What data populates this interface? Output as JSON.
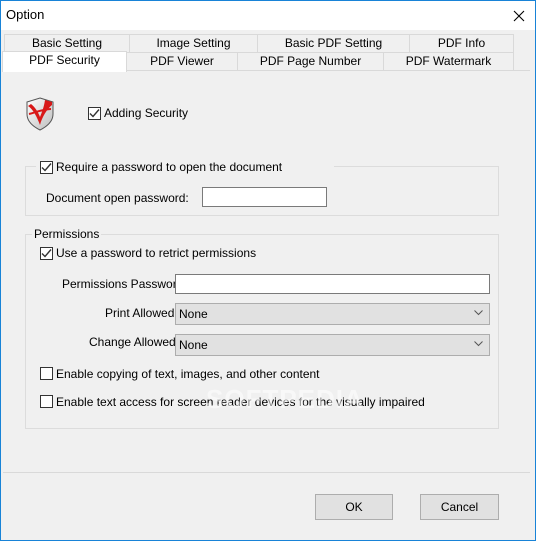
{
  "window": {
    "title": "Option",
    "close_label": "×"
  },
  "tabs": {
    "row_back": [
      {
        "label": "Basic Setting"
      },
      {
        "label": "Image Setting"
      },
      {
        "label": "Basic PDF Setting"
      },
      {
        "label": "PDF Info"
      }
    ],
    "row_front": [
      {
        "label": "PDF Security",
        "active": true
      },
      {
        "label": "PDF Viewer"
      },
      {
        "label": "PDF Page Number"
      },
      {
        "label": "PDF Watermark"
      }
    ]
  },
  "security": {
    "icon": "shield-icon",
    "adding_security_label": "Adding Security",
    "adding_security_checked": true
  },
  "open_password": {
    "require_label": "Require a password to open the document",
    "require_checked": true,
    "field_label": "Document open password:",
    "field_value": ""
  },
  "permissions": {
    "group_label": "Permissions",
    "use_password_label": "Use a password to retrict permissions",
    "use_password_checked": true,
    "password_label": "Permissions Password:",
    "password_value": "",
    "print_label": "Print Allowed:",
    "print_value": "None",
    "change_label": "Change Allowed:",
    "change_value": "None",
    "copy_label": "Enable copying of text, images, and other content",
    "copy_checked": false,
    "screen_reader_label": "Enable text access for screen reader devices for the visually impaired",
    "screen_reader_checked": false
  },
  "buttons": {
    "ok": "OK",
    "cancel": "Cancel"
  },
  "watermark_text": "SOFTPEDIA"
}
